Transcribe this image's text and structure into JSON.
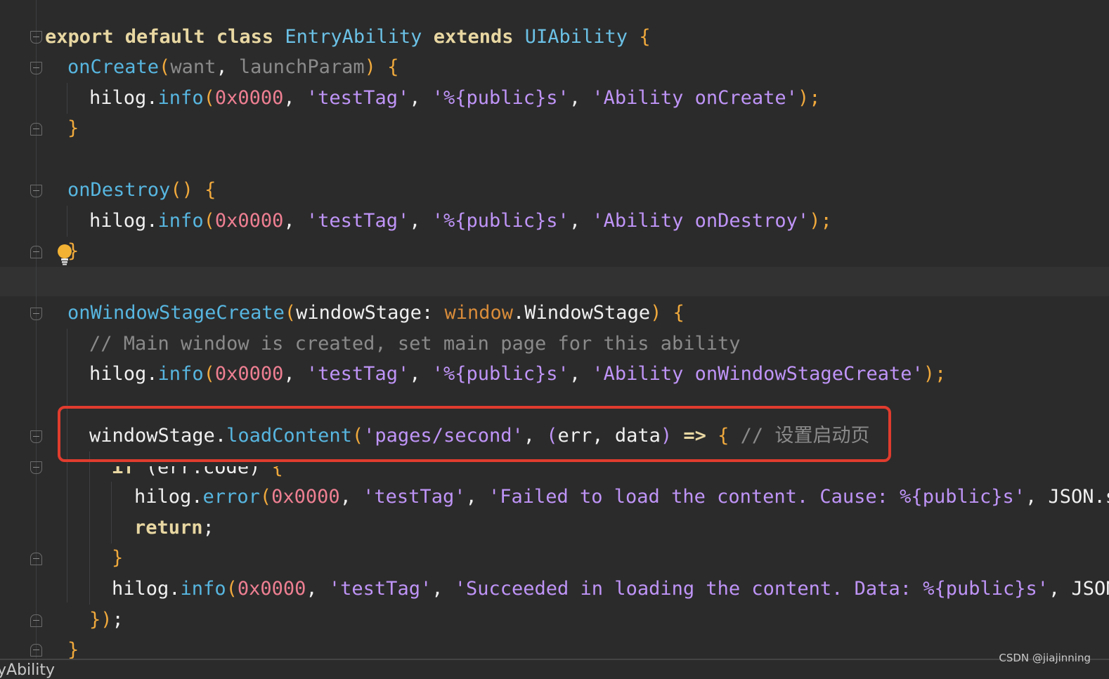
{
  "colors": {
    "background": "#2b2b2b",
    "highlight_box": "#e03c2e",
    "keyword": "#e8d7a2",
    "string": "#bf94f7",
    "number": "#ee7f92",
    "function": "#57b6e0",
    "comment": "#8a8a8a"
  },
  "icons": [
    "fold-marker-icon",
    "lightbulb-icon"
  ],
  "code": {
    "l1": {
      "kw": "export default class ",
      "cls": "EntryAbility",
      "kw2": " extends ",
      "cls2": "UIAbility",
      "brace": " {"
    },
    "l2": {
      "fn": "onCreate",
      "p1": "(",
      "param": "want",
      "c1": ", ",
      "param2": "launchParam",
      "p2": ")",
      "brace": " {"
    },
    "l3": {
      "obj": "hilog",
      "dot": ".",
      "fn": "info",
      "p1": "(",
      "num": "0x0000",
      "c1": ", ",
      "s1": "'testTag'",
      "c2": ", ",
      "s2": "'%{public}s'",
      "c3": ", ",
      "s3": "'Ability onCreate'",
      "end": ");"
    },
    "l4": {
      "brace": "}"
    },
    "l5": {
      "fn": "onDestroy",
      "p": "()",
      "brace": " {"
    },
    "l6": {
      "obj": "hilog",
      "dot": ".",
      "fn": "info",
      "p1": "(",
      "num": "0x0000",
      "c1": ", ",
      "s1": "'testTag'",
      "c2": ", ",
      "s2": "'%{public}s'",
      "c3": ", ",
      "s3": "'Ability onDestroy'",
      "end": ");"
    },
    "l7": {
      "brace": "}"
    },
    "l8": {
      "fn": "onWindowStageCreate",
      "p1": "(",
      "param": "windowStage",
      "colon": ": ",
      "type": "window",
      "dot": ".",
      "typecls": "WindowStage",
      "p2": ")",
      "brace": " {"
    },
    "l9": {
      "cmt": "// Main window is created, set main page for this ability"
    },
    "l10": {
      "obj": "hilog",
      "dot": ".",
      "fn": "info",
      "p1": "(",
      "num": "0x0000",
      "c1": ", ",
      "s1": "'testTag'",
      "c2": ", ",
      "s2": "'%{public}s'",
      "c3": ", ",
      "s3": "'Ability onWindowStageCreate'",
      "end": ");"
    },
    "l11": {
      "obj": "windowStage",
      "dot": ".",
      "fn": "loadContent",
      "p1": "(",
      "s1": "'pages/second'",
      "c1": ", ",
      "p2": "(",
      "a": "err",
      "c2": ", ",
      "b": "data",
      "p3": ")",
      "arrow": " => ",
      "brace": "{",
      "sp": " ",
      "cmt": "// 设置启动页"
    },
    "l12": {
      "kw": "if",
      "rest": " (err.code) ",
      "brace": "{"
    },
    "l13": {
      "obj": "hilog",
      "dot": ".",
      "fn": "error",
      "p1": "(",
      "num": "0x0000",
      "c1": ", ",
      "s1": "'testTag'",
      "c2": ", ",
      "s2": "'Failed to load the content. Cause: %{public}s'",
      "c3": ", ",
      "tail": "JSON.st"
    },
    "l14": {
      "kw": "return",
      "end": ";"
    },
    "l15": {
      "brace": "}"
    },
    "l16": {
      "obj": "hilog",
      "dot": ".",
      "fn": "info",
      "p1": "(",
      "num": "0x0000",
      "c1": ", ",
      "s1": "'testTag'",
      "c2": ", ",
      "s2": "'Succeeded in loading the content. Data: %{public}s'",
      "c3": ", ",
      "tail": "JSON."
    },
    "l17": {
      "brace": "})",
      "end": ";"
    },
    "l18": {
      "brace": "}"
    }
  },
  "bottom_text": "yAbility",
  "watermark": "CSDN @jiajinning"
}
